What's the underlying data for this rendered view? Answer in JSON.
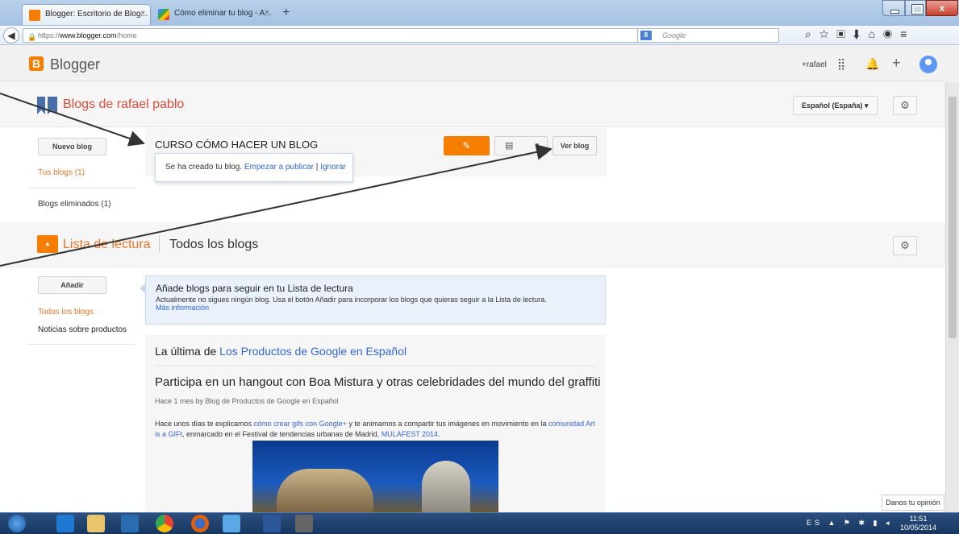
{
  "browser": {
    "tabs": [
      {
        "label": "Blogger: Escritorio de Blog...",
        "close": "×"
      },
      {
        "label": "Cómo eliminar tu blog - A...",
        "close": "×"
      }
    ],
    "new_tab": "+",
    "window_close": "x",
    "url_prefix": "https://",
    "url_host": "www.blogger.com",
    "url_path": "/home",
    "search_placeholder": "Google",
    "search_engine": "8"
  },
  "header": {
    "logo_letter": "B",
    "app_name": "Blogger",
    "user": "+rafael"
  },
  "blogs_section": {
    "title": "Blogs de rafael pablo",
    "language": "Español (España)",
    "new_blog_button": "Nuevo blog",
    "your_blogs": "Tus blogs (1)",
    "deleted_blogs": "Blogs eliminados (1)",
    "blog_name": "CURSO CÓMO HACER UN BLOG",
    "view_blog_button": "Ver blog",
    "created_msg": "Se ha creado tu blog.",
    "start_publishing": "Empezar a publicar",
    "separator": "|",
    "ignore": "Ignorar"
  },
  "reading_list": {
    "title": "Lista de lectura",
    "subtitle": "Todos los blogs",
    "add_button": "Añadir",
    "all_blogs": "Todos los blogs",
    "product_news": "Noticias sobre productos",
    "info_heading": "Añade blogs para seguir en tu Lista de lectura",
    "info_text": "Actualmente no sigues ningún blog. Usa el botón Añadir para incorporar los blogs que quieras seguir a la Lista de lectura.",
    "info_link": "Más información"
  },
  "feed": {
    "source_prefix": "La última de",
    "source_name": "Los Productos de Google en Español",
    "post_title": "Participa en un hangout con Boa Mistura y otras celebridades del mundo del graffiti",
    "post_meta": "Hace 1 mes by Blog de Productos de Google en Español",
    "body_1": "Hace unos días te explicamos",
    "body_link_1": "cómo crear gifs con Google+",
    "body_2": "y te animamos a compartir tus imágenes en movimiento en la",
    "body_link_2": "comunidad Art is a GIFt",
    "body_3": ", enmarcado en el Festival de tendencias urbanas de Madrid,",
    "body_link_3": "MULAFEST 2014",
    "body_4": "."
  },
  "feedback_button": "Danos tu opinión",
  "taskbar": {
    "language": "ES",
    "time": "11:51",
    "date": "10/05/2014"
  },
  "colors": {
    "accent_orange": "#f57d00",
    "title_red": "#dd4b39",
    "link_blue": "#3367d6"
  }
}
